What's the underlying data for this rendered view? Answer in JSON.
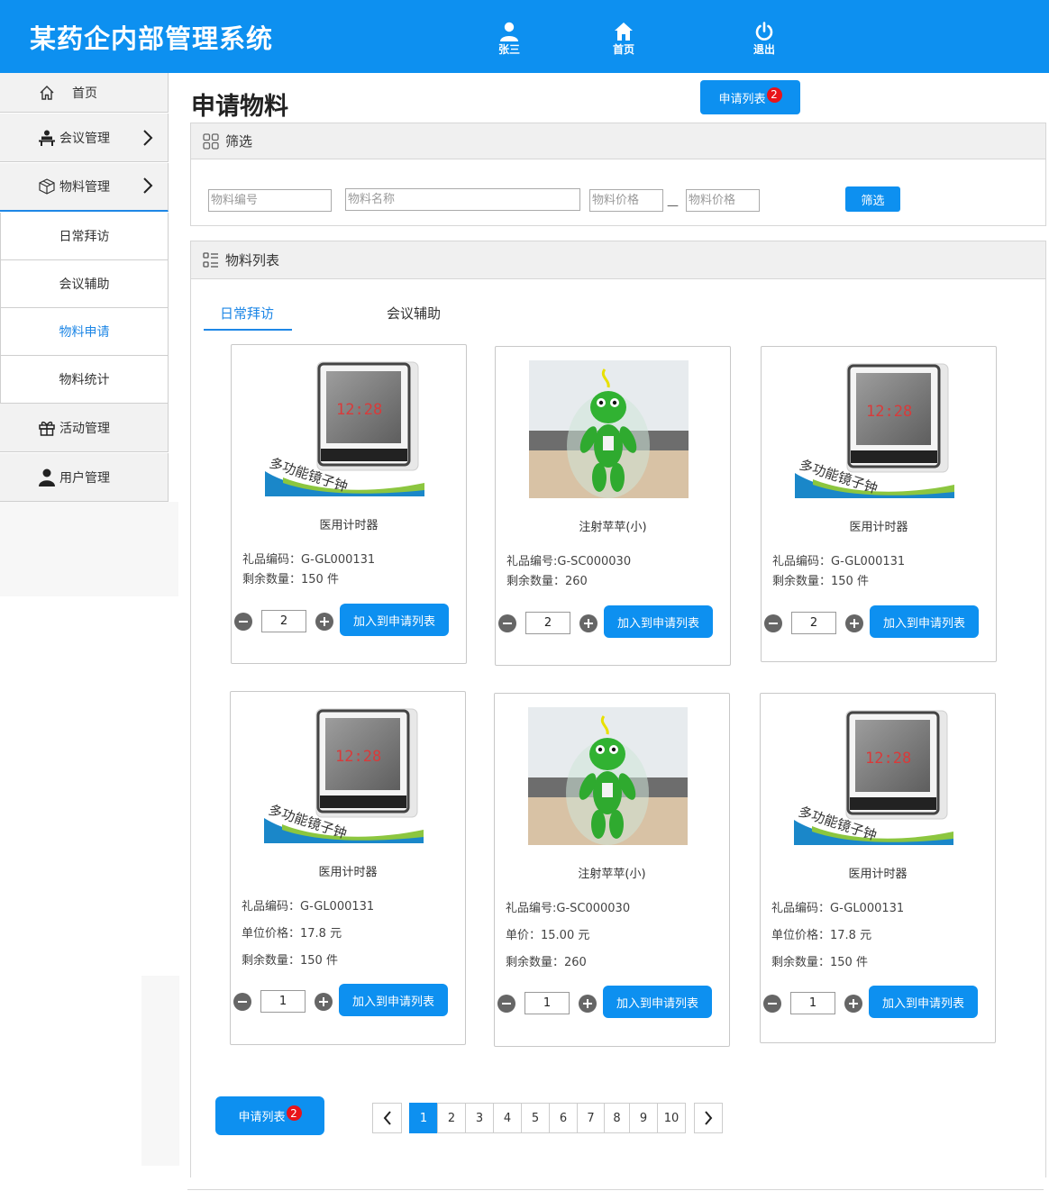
{
  "app": {
    "title": "某药企内部管理系统",
    "user": "张三",
    "home": "首页",
    "logout": "退出"
  },
  "sidebar": {
    "items": [
      {
        "label": "首页",
        "icon": "home-icon"
      },
      {
        "label": "会议管理",
        "icon": "meeting-icon"
      },
      {
        "label": "物料管理",
        "icon": "box-icon"
      },
      {
        "label": "活动管理",
        "icon": "gift-icon"
      },
      {
        "label": "用户管理",
        "icon": "user-icon"
      }
    ],
    "sub_items": [
      {
        "label": "日常拜访"
      },
      {
        "label": "会议辅助"
      },
      {
        "label": "物料申请"
      },
      {
        "label": "物料统计"
      }
    ],
    "active_sub": "物料申请"
  },
  "page": {
    "title": "申请物料",
    "apply_list_label": "申请列表",
    "apply_count": "2"
  },
  "filter": {
    "title": "筛选",
    "code_placeholder": "物料编号",
    "name_placeholder": "物料名称",
    "price_min_placeholder": "物料价格",
    "price_max_placeholder": "物料价格",
    "separator": "—",
    "button": "筛选"
  },
  "list": {
    "title": "物料列表",
    "tabs": [
      {
        "label": "日常拜访",
        "active": true
      },
      {
        "label": "会议辅助",
        "active": false
      }
    ],
    "add_label": "加入到申请列表",
    "cards": [
      {
        "image": "clock",
        "name": "医用计时器",
        "line1": "礼品编码：G-GL000131",
        "line2": "剩余数量：150 件",
        "line3": "",
        "qty": "2"
      },
      {
        "image": "frog",
        "name": "注射苹苹(小)",
        "line1": "礼品编号:G-SC000030",
        "line2": "剩余数量：260",
        "line3": "",
        "qty": "2"
      },
      {
        "image": "clock",
        "name": "医用计时器",
        "line1": "礼品编码：G-GL000131",
        "line2": "剩余数量：150 件",
        "line3": "",
        "qty": "2"
      },
      {
        "image": "clock",
        "name": "医用计时器",
        "line1": "礼品编码：G-GL000131",
        "line2": "单位价格：17.8 元",
        "line3": "剩余数量：150 件",
        "qty": "1"
      },
      {
        "image": "frog",
        "name": "注射苹苹(小)",
        "line1": "礼品编号:G-SC000030",
        "line2": "单价：15.00  元",
        "line3": "剩余数量：260",
        "qty": "1"
      },
      {
        "image": "clock",
        "name": "医用计时器",
        "line1": "礼品编码：G-GL000131",
        "line2": "单位价格：17.8 元",
        "line3": "剩余数量：150 件",
        "qty": "1"
      }
    ]
  },
  "pagination": {
    "pages": [
      "1",
      "2",
      "3",
      "4",
      "5",
      "6",
      "7",
      "8",
      "9",
      "10"
    ],
    "current": "1"
  },
  "clock_text": "多功能镜子钟",
  "clock_time": "12:28",
  "colors": {
    "primary": "#0d90f0",
    "badge": "#e8141a",
    "active_link": "#1e87e6"
  }
}
